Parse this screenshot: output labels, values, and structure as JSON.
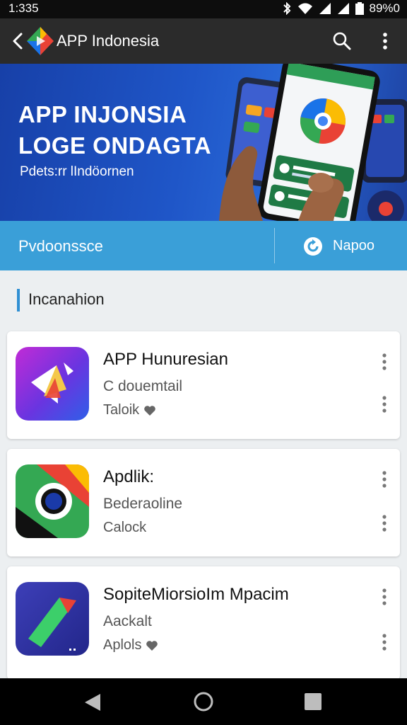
{
  "status_bar": {
    "time": "1:335",
    "battery_text": "89%0",
    "icons": [
      "bluetooth-icon",
      "wifi-icon",
      "signal-icon",
      "signal-icon",
      "battery-icon"
    ]
  },
  "app_bar": {
    "title": "APP Indonesia",
    "icons": [
      "back-arrow-icon",
      "app-logo",
      "search-icon",
      "more-vert-icon"
    ]
  },
  "banner": {
    "title_line1": "APP INJONSIA",
    "title_line2": "LOGE ONDAGTA",
    "subtitle": "Pdets:rr lIndöornen"
  },
  "action_strip": {
    "left_label": "Pvdoonssce",
    "right_label": "Napoo",
    "right_icon": "refresh-icon"
  },
  "section": {
    "label": "Incanahion"
  },
  "apps": [
    {
      "title": "APP Hunuresian",
      "subtitle": "C douemtail",
      "meta": "Taloik",
      "meta_icon": "heart-icon"
    },
    {
      "title": "Apdlik:",
      "subtitle": "Bederaoline",
      "meta": "Calock",
      "meta_icon": ""
    },
    {
      "title": "SopiteMiorsioIm Mpacim",
      "subtitle": "Aackalt",
      "meta": "Aplols",
      "meta_icon": "heart-icon"
    }
  ],
  "nav": {
    "icons": [
      "nav-back-icon",
      "nav-home-icon",
      "nav-recents-icon"
    ]
  },
  "colors": {
    "app_bar": "#2b2b2b",
    "banner": "#1f56c8",
    "action_strip": "#3a9fd8",
    "section_accent": "#2f8fd3"
  }
}
